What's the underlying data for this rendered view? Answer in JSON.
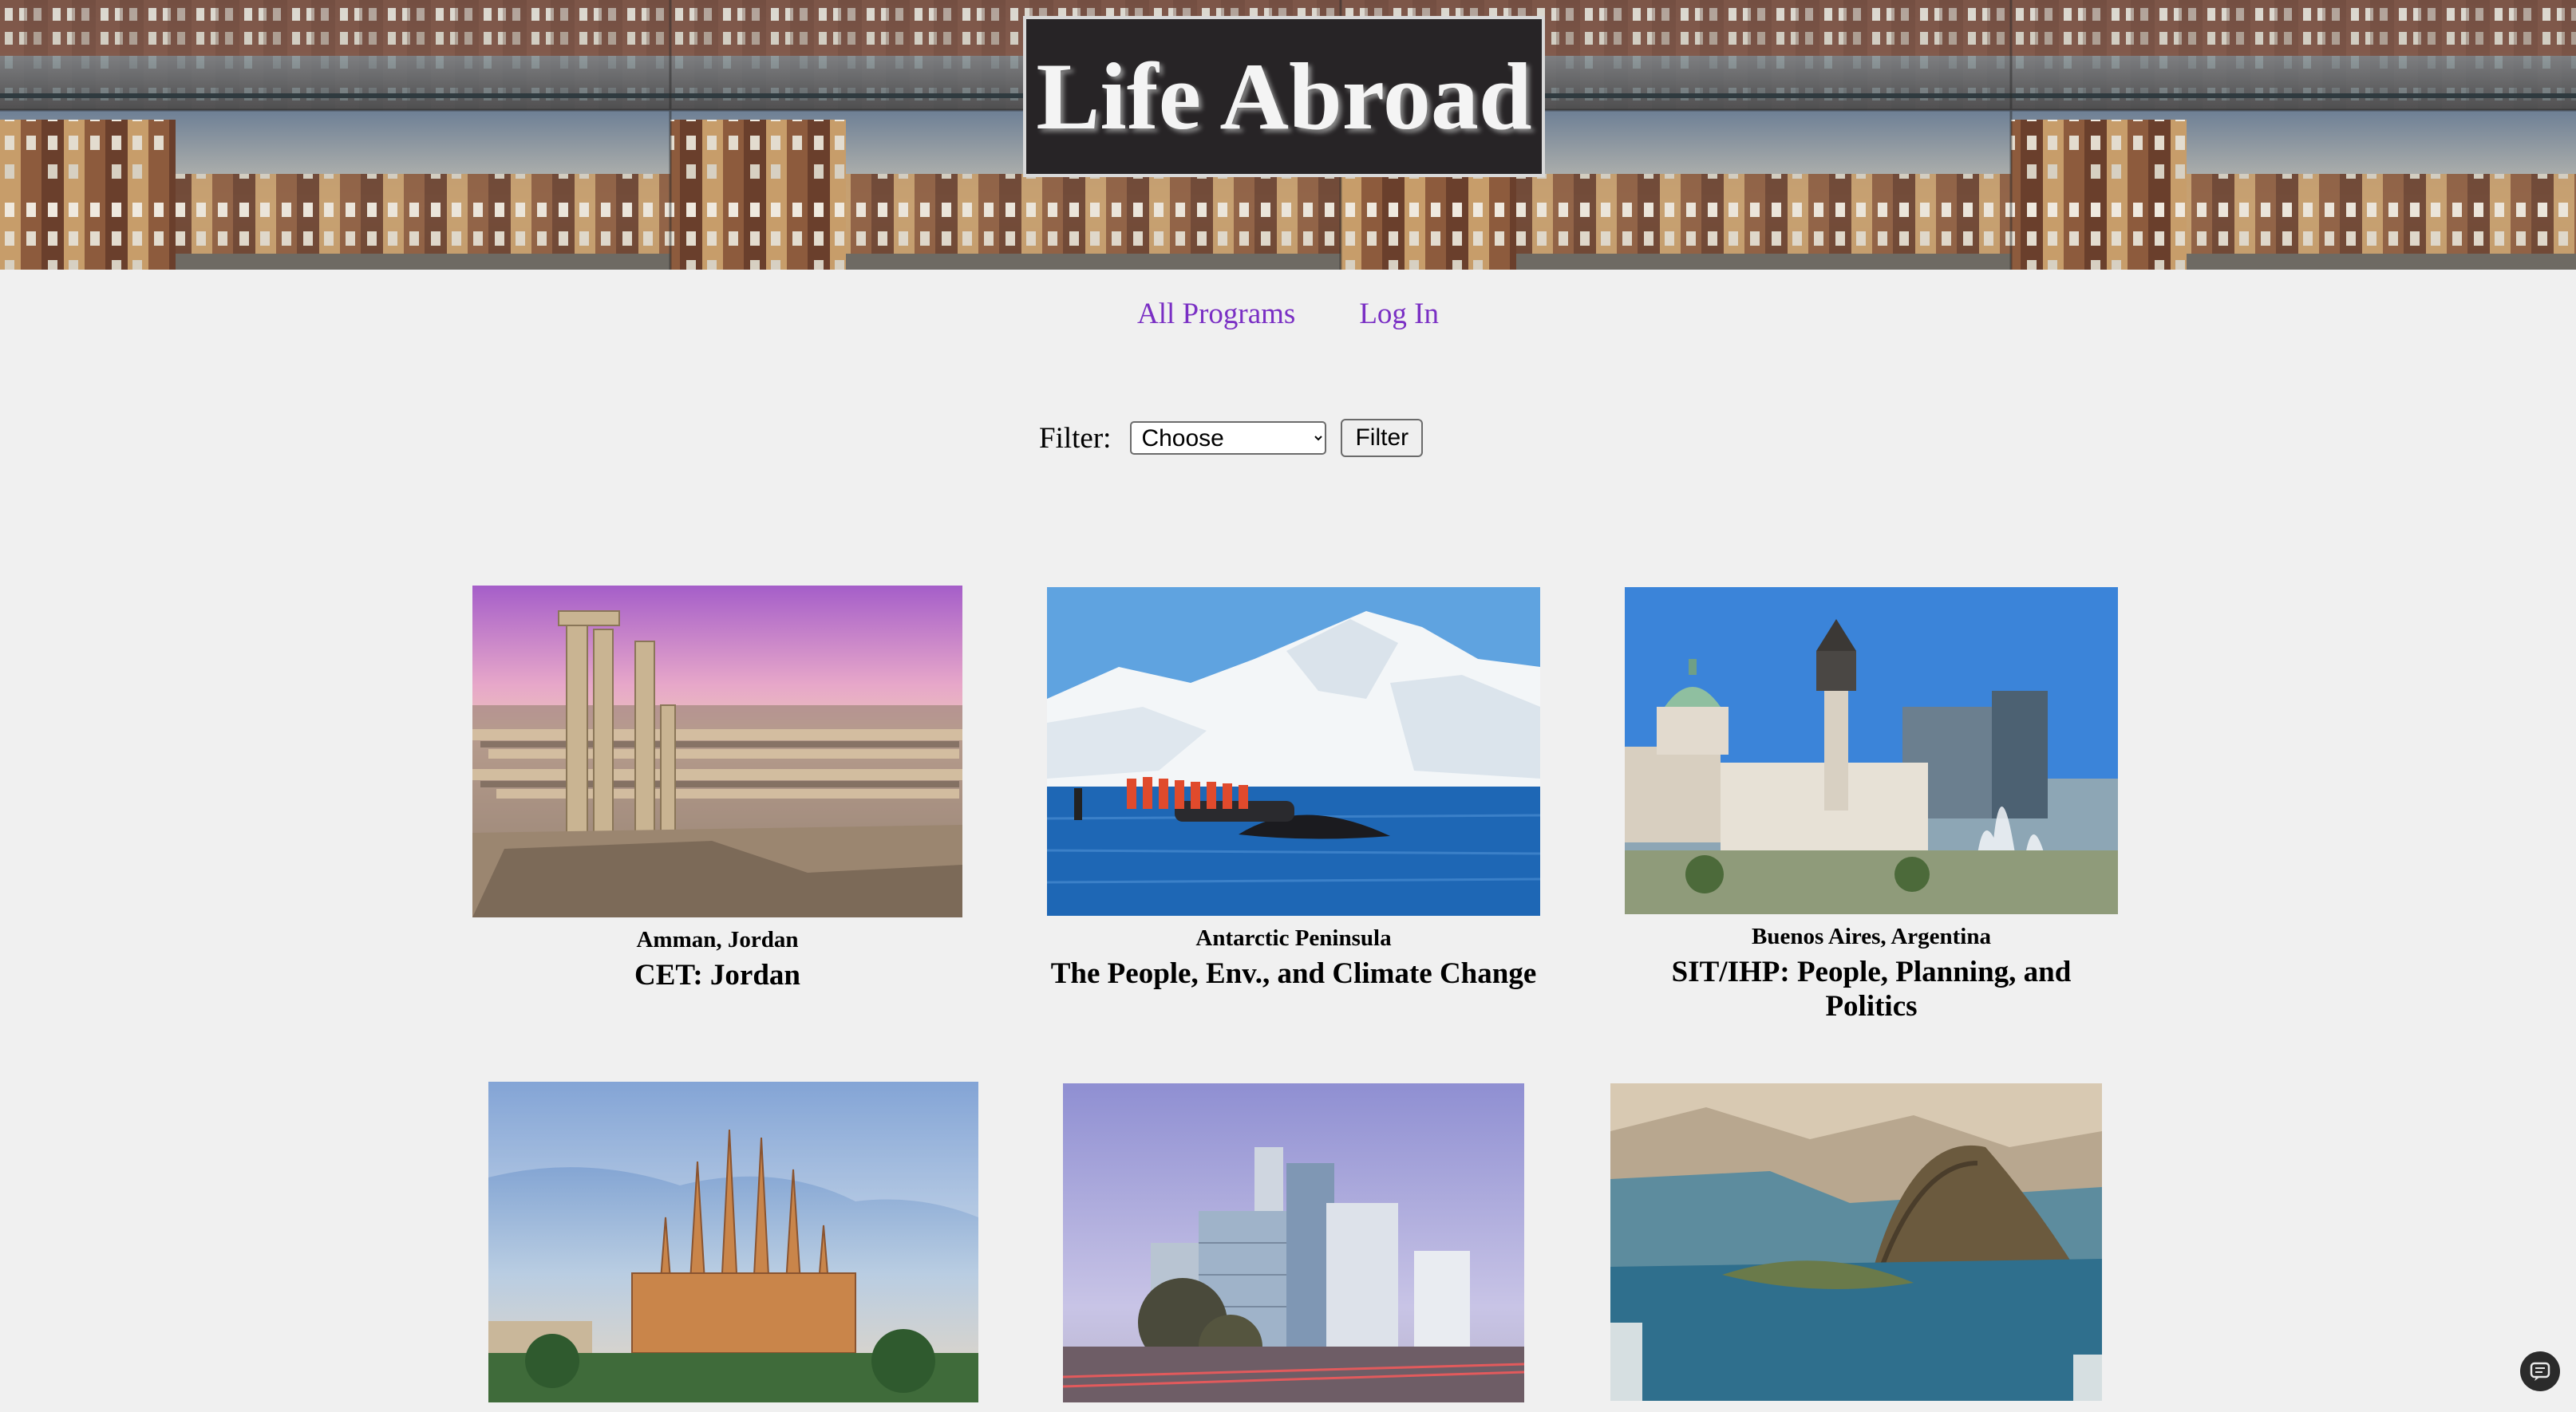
{
  "site": {
    "title": "Life Abroad"
  },
  "nav": {
    "all_programs": "All Programs",
    "log_in": "Log In"
  },
  "filter": {
    "label": "Filter:",
    "selected": "Choose",
    "button": "Filter"
  },
  "programs": [
    {
      "location": "Amman, Jordan",
      "name": "CET: Jordan"
    },
    {
      "location": "Antarctic Peninsula",
      "name": "The People, Env., and Climate Change"
    },
    {
      "location": "Buenos Aires, Argentina",
      "name": "SIT/IHP: People, Planning, and Politics"
    },
    {
      "location": "",
      "name": ""
    },
    {
      "location": "",
      "name": ""
    },
    {
      "location": "",
      "name": ""
    }
  ]
}
